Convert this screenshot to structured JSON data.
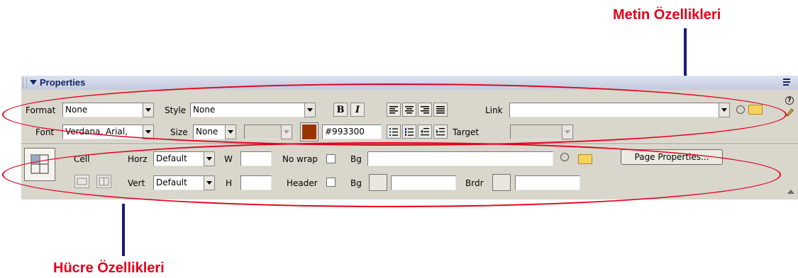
{
  "annotations": {
    "text_properties": "Metin Özellikleri",
    "cell_properties": "Hücre Özellikleri"
  },
  "panel": {
    "title": "Properties"
  },
  "text_row": {
    "format_label": "Format",
    "format_value": "None",
    "style_label": "Style",
    "style_value": "None",
    "bold_label": "B",
    "italic_label": "I",
    "link_label": "Link",
    "link_value": "",
    "font_label": "Font",
    "font_value": "Verdana, Arial,",
    "size_label": "Size",
    "size_value": "None",
    "color_value": "#993300",
    "color_swatch": "#993300",
    "target_label": "Target",
    "target_value": ""
  },
  "cell_row": {
    "cell_label": "Cell",
    "horz_label": "Horz",
    "horz_value": "Default",
    "w_label": "W",
    "w_value": "",
    "nowrap_label": "No wrap",
    "bg_label": "Bg",
    "bg_value": "",
    "page_properties_label": "Page Properties...",
    "vert_label": "Vert",
    "vert_value": "Default",
    "h_label": "H",
    "h_value": "",
    "header_label": "Header",
    "bg2_label": "Bg",
    "bg2_value": "",
    "brdr_label": "Brdr",
    "brdr_value": ""
  },
  "colors": {
    "annotation": "#e3001b",
    "pointer": "#1a1a7a",
    "panel_bg": "#d9d6cc"
  }
}
